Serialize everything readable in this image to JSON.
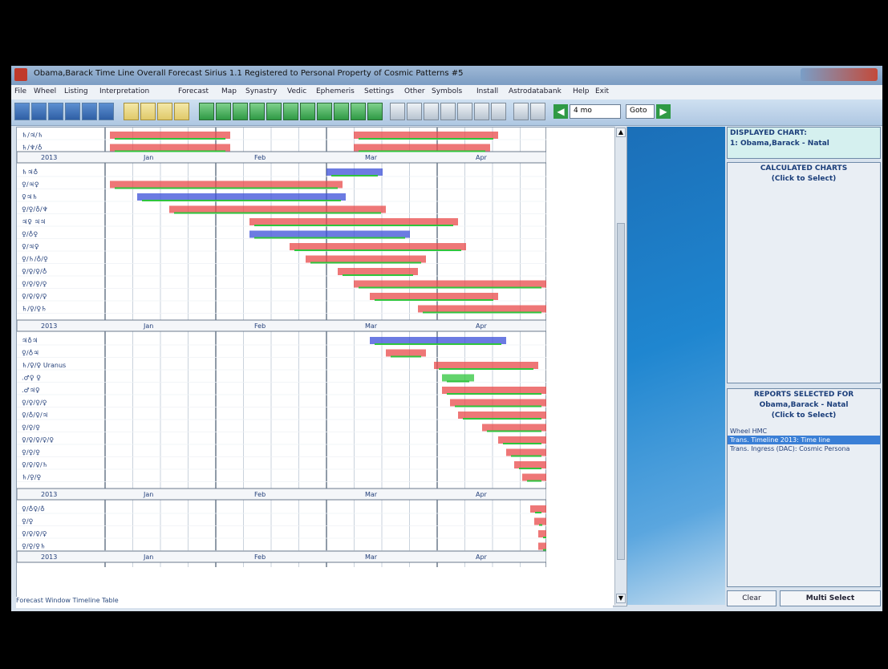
{
  "window": {
    "title": "Obama,Barack  Time Line Overall Forecast          Sirius 1.1    Registered to Personal Property of Cosmic Patterns #5"
  },
  "menu": [
    "File",
    "Wheel",
    "Listing",
    "Interpretation",
    "Forecast",
    "Map",
    "Synastry",
    "Vedic",
    "Ephemeris",
    "Settings",
    "Other",
    "Symbols",
    "Install",
    "Astrodatabank",
    "Help",
    "Exit"
  ],
  "toolbar": {
    "nav_value": "4 mo",
    "goto_label": "Goto",
    "back_icon": "left-arrow-icon",
    "forward_icon": "right-arrow-icon"
  },
  "timeline": {
    "year_label": "2013",
    "months": [
      "Jan",
      "Feb",
      "Mar",
      "Apr"
    ],
    "colors": {
      "red": "#e84a4a",
      "blue": "#3b4fd8",
      "green": "#2fc53c"
    },
    "row_labels_block1": [
      "♄/♃/♄",
      "♄/♆/♁"
    ],
    "row_labels_block2": [
      "♄♃♁",
      "♀/♃♀",
      "♀♃♄",
      "♀/♀/♁/♆",
      "♃♀ ♃♃",
      "♀/♁♀",
      "♀/♃♀",
      "♀/♄/♁/♀",
      "♀/♀/♀/♁",
      "♀/♀/♀/♀",
      "♀/♀/♀/♀",
      "♄/♀/♀♄"
    ],
    "row_labels_block3": [
      "♃♁♃",
      "♀/♁♃",
      "♄/♀/♀ Uranus",
      ".♂♀ ♀",
      ".♂♃♀",
      "♀/♀/♀/♀",
      "♀/♁/♀/♃",
      "♀/♀/♀",
      "♀/♀/♀/♀/♀",
      "♀/♀/♀",
      "♀/♀/♀/♄",
      "♄/♀/♀"
    ],
    "row_labels_block4": [
      "♀/♁♀/♁",
      "♀/♀",
      "♀/♀/♀/♀",
      "♀/♀/♀♄"
    ]
  },
  "status": "Forecast Window Timeline Table",
  "side": {
    "displayed_head": "DISPLAYED CHART:",
    "displayed_value": "1: Obama,Barack - Natal",
    "calc_head": "CALCULATED CHARTS",
    "calc_sub": "(Click to Select)",
    "reports_head": "REPORTS SELECTED FOR",
    "reports_name": "Obama,Barack - Natal",
    "reports_sub": "(Click to Select)",
    "reports": [
      "Wheel HMC",
      "Trans. Timeline 2013: Time line",
      "Trans. Ingress (DAC): Cosmic Persona"
    ],
    "clear_label": "Clear",
    "multi_label": "Multi Select"
  }
}
